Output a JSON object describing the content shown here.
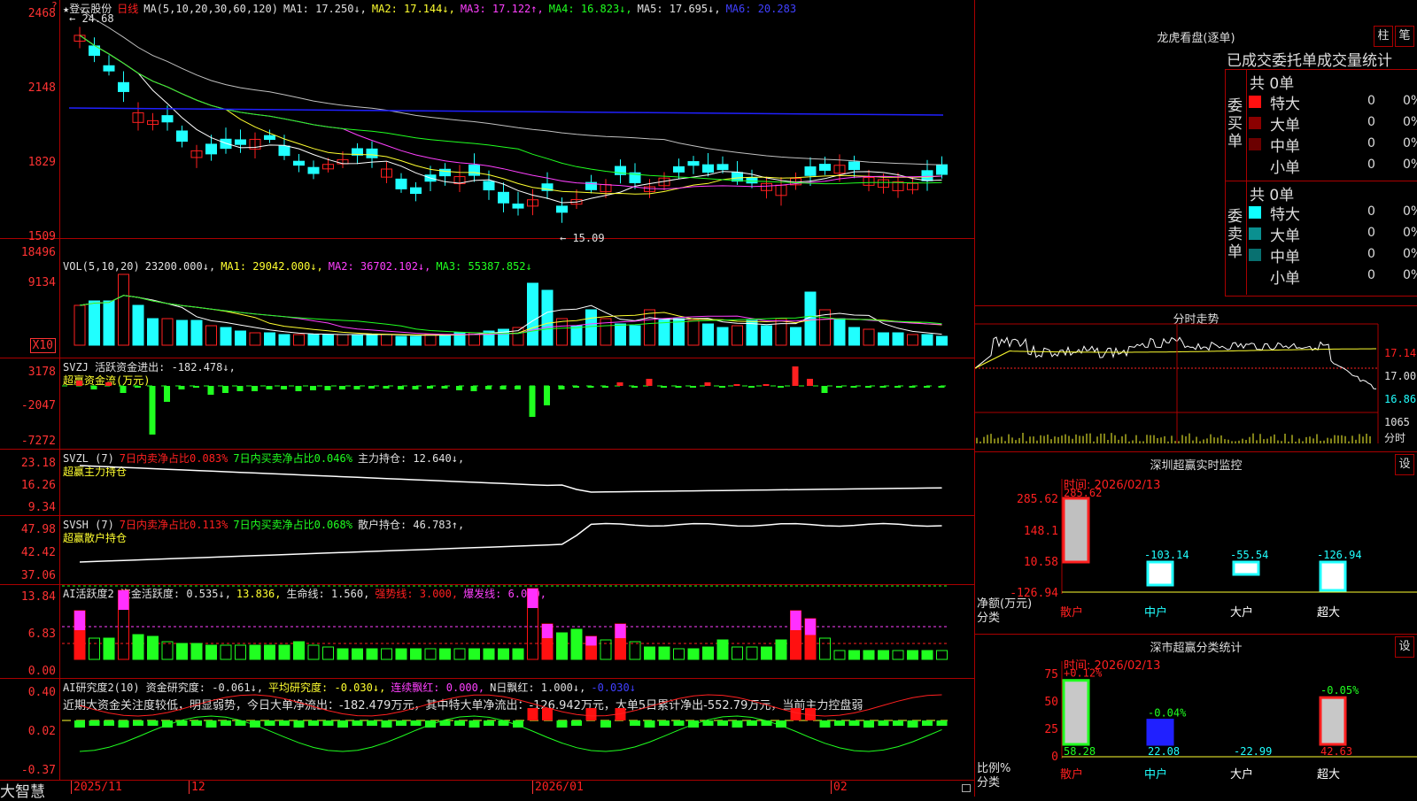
{
  "app": {
    "logo": "大智慧"
  },
  "main": {
    "header": {
      "stock": "★登云股份",
      "period": "日线",
      "ma_label": "MA(5,10,20,30,60,120)",
      "ma1": "MA1: 17.250↓,",
      "ma2": "MA2: 17.144↓,",
      "ma3": "MA3: 17.122↑,",
      "ma4": "MA4: 16.823↓,",
      "ma5": "MA5: 17.695↓,",
      "ma6": "MA6: 20.283"
    },
    "yaxis": [
      "2468",
      "2148",
      "1829",
      "1509"
    ],
    "annot_high": "24.68",
    "annot_low": "15.09"
  },
  "vol": {
    "label": "VOL(5,10,20)",
    "value": "23200.000↓,",
    "ma1": "MA1: 29042.000↓,",
    "ma2": "MA2: 36702.102↓,",
    "ma3": "MA3: 55387.852↓",
    "yaxis": [
      "18496",
      "9134"
    ],
    "unit": "X10"
  },
  "svzj": {
    "label": "SVZJ  活跃资金进出: -182.478↓,",
    "sub": "超赢资金流(万元)",
    "yaxis": [
      "3178",
      "-2047",
      "-7272"
    ]
  },
  "svzl": {
    "label": "SVZL (7)",
    "a": "7日内卖净占比0.083%",
    "b": "7日内买卖净占比0.046%",
    "c": "主力持仓: 12.640↓,",
    "sub": "超赢主力持仓",
    "yaxis": [
      "23.18",
      "16.26",
      "9.34"
    ]
  },
  "svsh": {
    "label": "SVSH (7)",
    "a": "7日内卖净占比0.113%",
    "b": "7日内买卖净占比0.068%",
    "c": "散户持仓: 46.783↑,",
    "sub": "超赢散户持仓",
    "yaxis": [
      "47.98",
      "42.42",
      "37.06"
    ]
  },
  "ai1": {
    "label": "AI活跃度2 资金活跃度: 0.535↓,",
    "v2": "13.836,",
    "v3": "生命线: 1.560,",
    "v4": "强势线: 3.000,",
    "v5": "爆发线: 6.000,",
    "yaxis": [
      "13.84",
      "6.83",
      "0.00"
    ]
  },
  "ai2": {
    "label": "AI研究度2(10) 资金研究度: -0.061↓,",
    "v2": "平均研究度: -0.030↓,",
    "v3": "连续飘红: 0.000,",
    "v4": "N日飘红: 1.000↓,",
    "v5": "-0.030↓",
    "comment": "近期大资金关注度较低，明显弱势，今日大单净流出：-182.479万元，其中特大单净流出：-126.942万元，大单5日累计净出-552.79万元，当前主力控盘弱",
    "yaxis": [
      "0.40",
      "0.02",
      "-0.37"
    ]
  },
  "xaxis": [
    "2025/11",
    "12",
    "2026/01",
    "02"
  ],
  "lhb": {
    "title": "龙虎看盘(逐单)",
    "btn1": "柱",
    "btn2": "笔",
    "stats_title": "已成交委托单成交量统计",
    "buy_side": "委买单",
    "sell_side": "委卖单",
    "buy_total": "共 0单",
    "sell_total": "共 0单",
    "buy": [
      {
        "name": "特大",
        "count": "0",
        "pct": "0%",
        "color": "#ff1010"
      },
      {
        "name": "大单",
        "count": "0",
        "pct": "0%",
        "color": "#8b0000"
      },
      {
        "name": "中单",
        "count": "0",
        "pct": "0%",
        "color": "#6b0000"
      },
      {
        "name": "小单",
        "count": "0",
        "pct": "0%",
        "color": ""
      }
    ],
    "sell": [
      {
        "name": "特大",
        "count": "0",
        "pct": "0%",
        "color": "#10ffff"
      },
      {
        "name": "大单",
        "count": "0",
        "pct": "0%",
        "color": "#0a9090"
      },
      {
        "name": "中单",
        "count": "0",
        "pct": "0%",
        "color": "#087070"
      },
      {
        "name": "小单",
        "count": "0",
        "pct": "0%",
        "color": ""
      }
    ]
  },
  "intraday": {
    "title": "分时走势",
    "prices": [
      "17.14",
      "17.00",
      "16.86"
    ],
    "vol": "1065",
    "vol_label": "分时"
  },
  "sz_monitor": {
    "title": "深圳超赢实时监控",
    "btn": "设",
    "time": "时间: 2026/02/13",
    "yaxis": [
      "285.62",
      "148.1",
      "10.58",
      "-126.94"
    ],
    "ylabel": "净额(万元)",
    "cat_label": "分类",
    "bar_labels": [
      "285.62",
      "-103.14",
      "-55.54",
      "-126.94"
    ],
    "values": [
      285.62,
      -103.14,
      -55.54,
      -126.94
    ],
    "categories": [
      "散户",
      "中户",
      "大户",
      "超大"
    ]
  },
  "sh_stats": {
    "title": "深市超赢分类统计",
    "btn": "设",
    "time": "时间: 2026/02/13",
    "yaxis": [
      "75",
      "50",
      "25",
      "0"
    ],
    "ylabel": "比例%",
    "cat_label": "分类",
    "top_labels": [
      "+0.12%",
      "-0.04%",
      "",
      "-0.05%"
    ],
    "values": [
      58.28,
      22.08,
      -22.99,
      42.63
    ],
    "bottom_labels": [
      "58.28",
      "22.08",
      "-22.99",
      "42.63"
    ],
    "categories": [
      "散户",
      "中户",
      "大户",
      "超大"
    ]
  },
  "colors": {
    "up": "#ff2020",
    "down": "#20ffff",
    "frame": "#aa0000"
  }
}
